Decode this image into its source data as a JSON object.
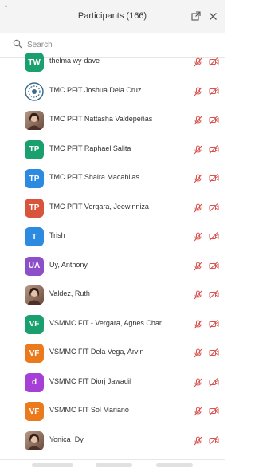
{
  "header": {
    "title": "Participants (166)"
  },
  "search": {
    "placeholder": "Search"
  },
  "colors": {
    "muted_red": "#d9534f",
    "teal": "#1aa06e",
    "blue": "#2c8ae0",
    "red": "#d9543c",
    "orange": "#ea7a1c",
    "purple": "#8c4fc9",
    "violet": "#a63fd6"
  },
  "participants": [
    {
      "name": "thelma wy-dave",
      "avatar_type": "initials",
      "initials": "TW",
      "color": "#1aa06e",
      "mic": "muted",
      "video": "off"
    },
    {
      "name": "TMC PFIT Joshua Dela Cruz",
      "avatar_type": "logo",
      "icon": "logo-badge-icon",
      "mic": "muted",
      "video": "off"
    },
    {
      "name": "TMC PFIT Nattasha Valdepeñas",
      "avatar_type": "photo",
      "icon": "photo-avatar-icon",
      "mic": "muted",
      "video": "off"
    },
    {
      "name": "TMC PFIT Raphael Salita",
      "avatar_type": "initials",
      "initials": "TP",
      "color": "#1aa06e",
      "mic": "muted",
      "video": "off"
    },
    {
      "name": "TMC PFIT Shaira Macahilas",
      "avatar_type": "initials",
      "initials": "TP",
      "color": "#2c8ae0",
      "mic": "muted",
      "video": "off"
    },
    {
      "name": "TMC PFIT Vergara, Jeewinniza",
      "avatar_type": "initials",
      "initials": "TP",
      "color": "#d9543c",
      "mic": "muted",
      "video": "off"
    },
    {
      "name": "Trish",
      "avatar_type": "initials",
      "initials": "T",
      "color": "#2c8ae0",
      "mic": "muted",
      "video": "off"
    },
    {
      "name": "Uy, Anthony",
      "avatar_type": "initials",
      "initials": "UA",
      "color": "#8c4fc9",
      "mic": "muted",
      "video": "off"
    },
    {
      "name": "Valdez, Ruth",
      "avatar_type": "photo",
      "icon": "photo-avatar-icon",
      "mic": "muted",
      "video": "off"
    },
    {
      "name": "VSMMC FIT - Vergara, Agnes Char...",
      "avatar_type": "initials",
      "initials": "VF",
      "color": "#1aa06e",
      "mic": "muted",
      "video": "off"
    },
    {
      "name": "VSMMC FIT Dela Vega, Arvin",
      "avatar_type": "initials",
      "initials": "VF",
      "color": "#ea7a1c",
      "mic": "muted",
      "video": "off"
    },
    {
      "name": "VSMMC FIT Diorj Jawadil",
      "avatar_type": "initials",
      "initials": "d",
      "color": "#a63fd6",
      "mic": "muted",
      "video": "off"
    },
    {
      "name": "VSMMC FIT Sol Mariano",
      "avatar_type": "initials",
      "initials": "VF",
      "color": "#ea7a1c",
      "mic": "muted",
      "video": "off"
    },
    {
      "name": "Yonica_Dy",
      "avatar_type": "photo",
      "icon": "photo-avatar-icon",
      "mic": "muted",
      "video": "off"
    }
  ]
}
